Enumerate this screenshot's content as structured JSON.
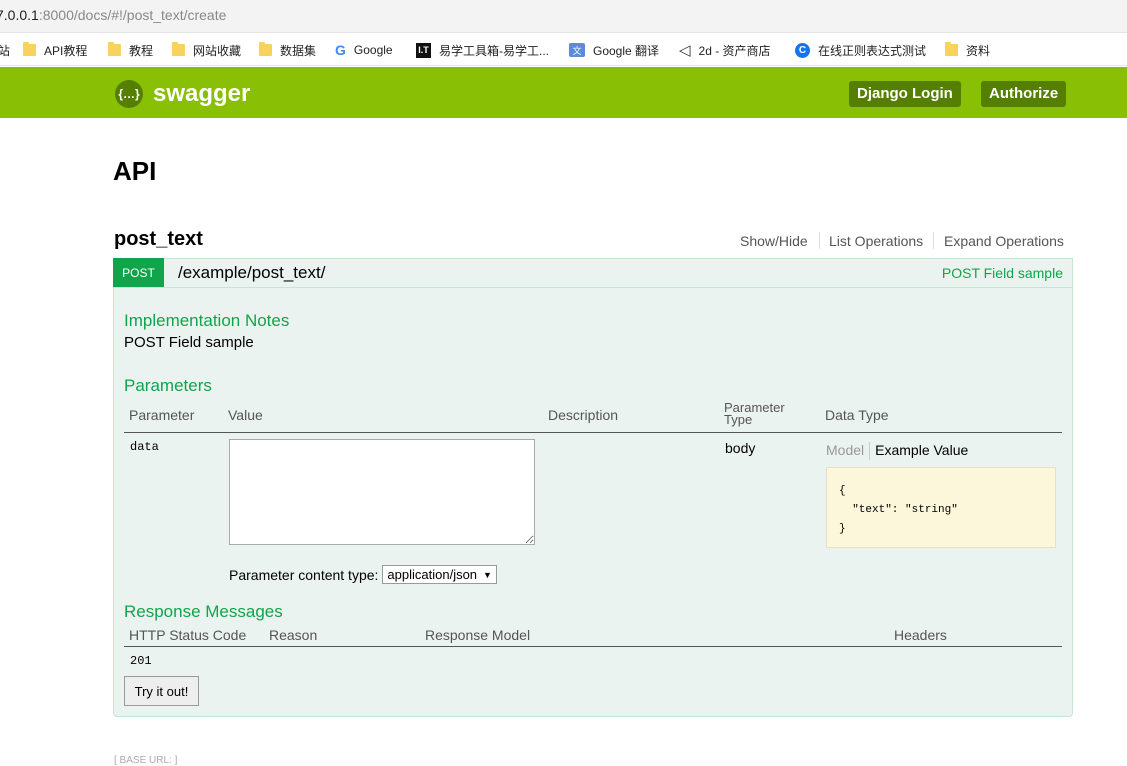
{
  "browser": {
    "url_prefix": "7.0.0.1",
    "url_rest": ":8000/docs/#!/post_text/create",
    "bookmarks": [
      {
        "label": "站",
        "icon": "folder-icon"
      },
      {
        "label": "API教程",
        "icon": "folder-icon"
      },
      {
        "label": "教程",
        "icon": "folder-icon"
      },
      {
        "label": "网站收藏",
        "icon": "folder-icon"
      },
      {
        "label": "数据集",
        "icon": "folder-icon"
      },
      {
        "label": "Google",
        "icon": "google-icon"
      },
      {
        "label": "易学工具箱-易学工...",
        "icon": "it-icon"
      },
      {
        "label": "Google 翻译",
        "icon": "translate-icon"
      },
      {
        "label": "2d - 资产商店",
        "icon": "unity-icon"
      },
      {
        "label": "在线正则表达式测试",
        "icon": "chrome-icon"
      },
      {
        "label": "资料",
        "icon": "folder-icon"
      }
    ]
  },
  "header": {
    "logo_text": "swagger",
    "logo_symbol": "{…}",
    "login_label": "Django Login",
    "authorize_label": "Authorize",
    "accent_color": "#89bf04"
  },
  "page": {
    "title": "API"
  },
  "resource": {
    "name": "post_text",
    "ops": [
      "Show/Hide",
      "List Operations",
      "Expand Operations"
    ]
  },
  "operation": {
    "method": "POST",
    "path": "/example/post_text/",
    "summary": "POST Field sample",
    "impl_notes_heading": "Implementation Notes",
    "impl_notes": "POST Field sample",
    "parameters_heading": "Parameters",
    "param_headers": {
      "parameter": "Parameter",
      "value": "Value",
      "description": "Description",
      "param_type_line1": "Parameter",
      "param_type_line2": "Type",
      "data_type": "Data Type"
    },
    "param": {
      "name": "data",
      "value": "",
      "type": "body",
      "model_tab": "Model",
      "example_tab": "Example Value",
      "example_value": "{\n  \"text\": \"string\"\n}"
    },
    "content_type_label": "Parameter content type:",
    "content_type_value": "application/json",
    "responses_heading": "Response Messages",
    "response_headers": {
      "code": "HTTP Status Code",
      "reason": "Reason",
      "model": "Response Model",
      "headers": "Headers"
    },
    "response_code": "201",
    "try_label": "Try it out!"
  },
  "footer": "[ BASE URL: ]"
}
